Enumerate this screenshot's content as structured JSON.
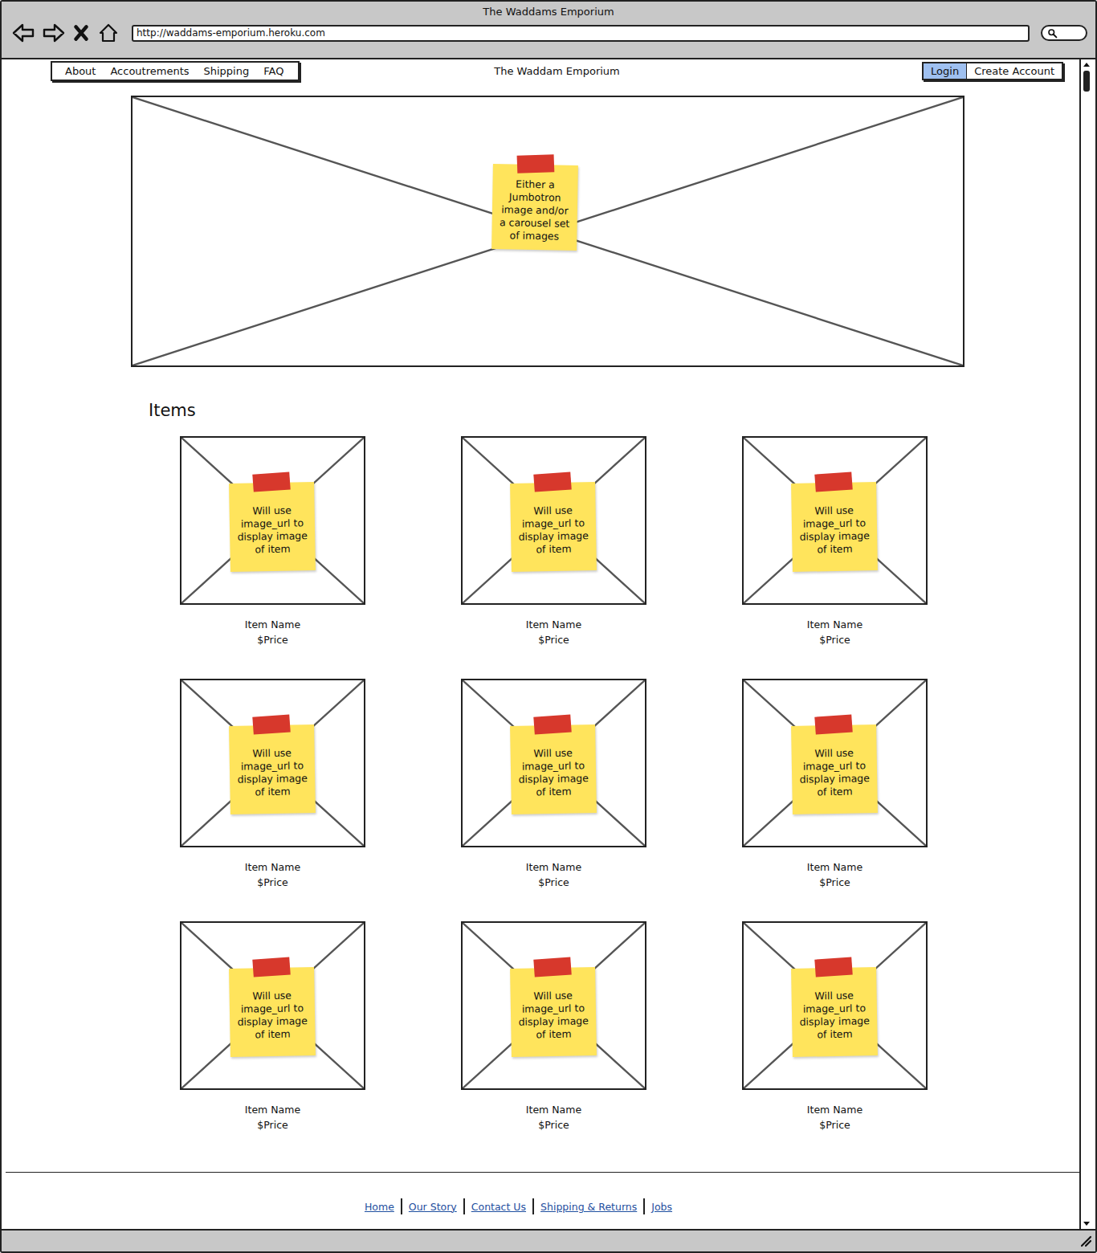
{
  "window": {
    "title": "The Waddams Emporium",
    "url": "http://waddams-emporium.heroku.com"
  },
  "nav_links": [
    "About",
    "Accoutrements",
    "Shipping",
    "FAQ"
  ],
  "site_title": "The Waddam Emporium",
  "auth_buttons": [
    {
      "label": "Login",
      "selected": true
    },
    {
      "label": "Create Account",
      "selected": false
    }
  ],
  "hero": {
    "note": "Either a Jumbotron image and/or a carousel set of images"
  },
  "items_heading": "Items",
  "items": [
    {
      "name": "Item Name",
      "price": "$Price",
      "note": "Will use image_url to display image of item"
    },
    {
      "name": "Item Name",
      "price": "$Price",
      "note": "Will use image_url to display image of item"
    },
    {
      "name": "Item Name",
      "price": "$Price",
      "note": "Will use image_url to display image of item"
    },
    {
      "name": "Item Name",
      "price": "$Price",
      "note": "Will use image_url to display image of item"
    },
    {
      "name": "Item Name",
      "price": "$Price",
      "note": "Will use image_url to display image of item"
    },
    {
      "name": "Item Name",
      "price": "$Price",
      "note": "Will use image_url to display image of item"
    },
    {
      "name": "Item Name",
      "price": "$Price",
      "note": "Will use image_url to display image of item"
    },
    {
      "name": "Item Name",
      "price": "$Price",
      "note": "Will use image_url to display image of item"
    },
    {
      "name": "Item Name",
      "price": "$Price",
      "note": "Will use image_url to display image of item"
    }
  ],
  "footer_links": [
    "Home",
    "Our Story",
    "Contact Us",
    "Shipping & Returns",
    "Jobs"
  ]
}
